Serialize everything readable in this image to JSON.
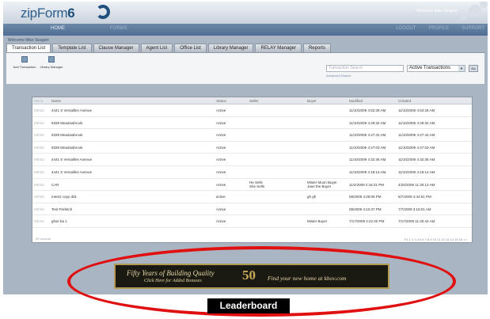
{
  "app": {
    "logo_text": "zipForm",
    "logo_version": "6"
  },
  "header": {
    "welcome_text": "Welcome Mike Seagert"
  },
  "nav": {
    "home_label": "HOME",
    "forms_label": "FORMS",
    "right_items": [
      "LOGOUT",
      "PROFILE",
      "SUPPORT"
    ]
  },
  "user_line": "Welcome Mike Seagert",
  "tabs": [
    {
      "label": "Transaction List",
      "active": true
    },
    {
      "label": "Template List"
    },
    {
      "label": "Clause Manager"
    },
    {
      "label": "Agent List"
    },
    {
      "label": "Office List"
    },
    {
      "label": "Library Manager"
    },
    {
      "label": "RELAY Manager"
    },
    {
      "label": "Reports"
    }
  ],
  "toolbar": {
    "tools": [
      {
        "label": "Add Transaction"
      },
      {
        "label": "Library Manager"
      }
    ],
    "search_placeholder": "Transaction Search",
    "advanced_link": "Advanced Search",
    "filter_value": "Active Transactions",
    "go_label": "Go"
  },
  "table": {
    "columns": [
      "Menu",
      "Name",
      "Status",
      "Seller",
      "Buyer",
      "Modified",
      "Created"
    ],
    "rows": [
      {
        "menu": "MENU",
        "name": "4441 S Versailles Avenue",
        "status": "Active",
        "seller": "",
        "buyer": "",
        "modified": "11/10/2009 4:53:28 AM",
        "created": "11/10/2009 4:53:28 AM"
      },
      {
        "menu": "MENU",
        "name": "9339 Meadowbrook",
        "status": "Active",
        "seller": "",
        "buyer": "",
        "modified": "11/10/2009 4:49:32 AM",
        "created": "11/10/2009 4:49:32 AM"
      },
      {
        "menu": "MENU",
        "name": "9339 Meadowbrook",
        "status": "Active",
        "seller": "",
        "buyer": "",
        "modified": "11/10/2009 4:47:42 AM",
        "created": "11/10/2009 4:47:42 AM"
      },
      {
        "menu": "MENU",
        "name": "9339 Meadowbrook",
        "status": "Active",
        "seller": "",
        "buyer": "",
        "modified": "11/10/2009 4:47:03 AM",
        "created": "11/10/2009 4:47:03 AM"
      },
      {
        "menu": "MENU",
        "name": "4441 S Versailles Avenue",
        "status": "Active",
        "seller": "",
        "buyer": "",
        "modified": "11/10/2009 4:32:36 AM",
        "created": "11/10/2009 4:32:36 AM"
      },
      {
        "menu": "MENU",
        "name": "4441 S Versailles Avenue",
        "status": "Active",
        "seller": "",
        "buyer": "",
        "modified": "11/10/2009 4:18:14 AM",
        "created": "11/10/2009 4:18:14 AM"
      },
      {
        "menu": "MENU",
        "name": "CAR",
        "status": "Active",
        "seller": "He Sells\nShe Sells",
        "buyer": "Mister Moon Buyer\nJane the Buyer",
        "modified": "11/2/2009 2:16:31 PM",
        "created": "4/20/2009 11:30:13 AM"
      },
      {
        "menu": "MENU",
        "name": "meet1 copy dd1",
        "status": "active",
        "seller": "",
        "buyer": "gh gh",
        "modified": "09/2009 4:29:08 PM",
        "created": "5/7/2009 4:44:51 PM"
      },
      {
        "menu": "MENU",
        "name": "Test Prefetch",
        "status": "Active",
        "seller": "",
        "buyer": "",
        "modified": "09/2009 4:10:37 PM",
        "created": "7/7/2009 3:18:01 AM"
      },
      {
        "menu": "MENU",
        "name": "ghse ba 1",
        "status": "Active",
        "seller": "",
        "buyer": "Mister Buyer",
        "modified": "7/17/2009 4:22:40 PM",
        "created": "7/17/2009 11:40:42 AM"
      }
    ],
    "footer_count": "50 records",
    "pager": "P1 1 2 3 4 5 6 7 8 9 10 11 12 13 14 15 16 >>"
  },
  "banner": {
    "line1": "Fifty Years of Building Quality",
    "line2": "Click Here for Added Bonuses",
    "logo_number": "50",
    "line3": "Find your new home at khov.com"
  },
  "leaderboard_label": "Leaderboard",
  "colors": {
    "highlight_ring": "#e01010",
    "banner_gold": "#b49a52",
    "nav_blue": "#4f6e93"
  }
}
